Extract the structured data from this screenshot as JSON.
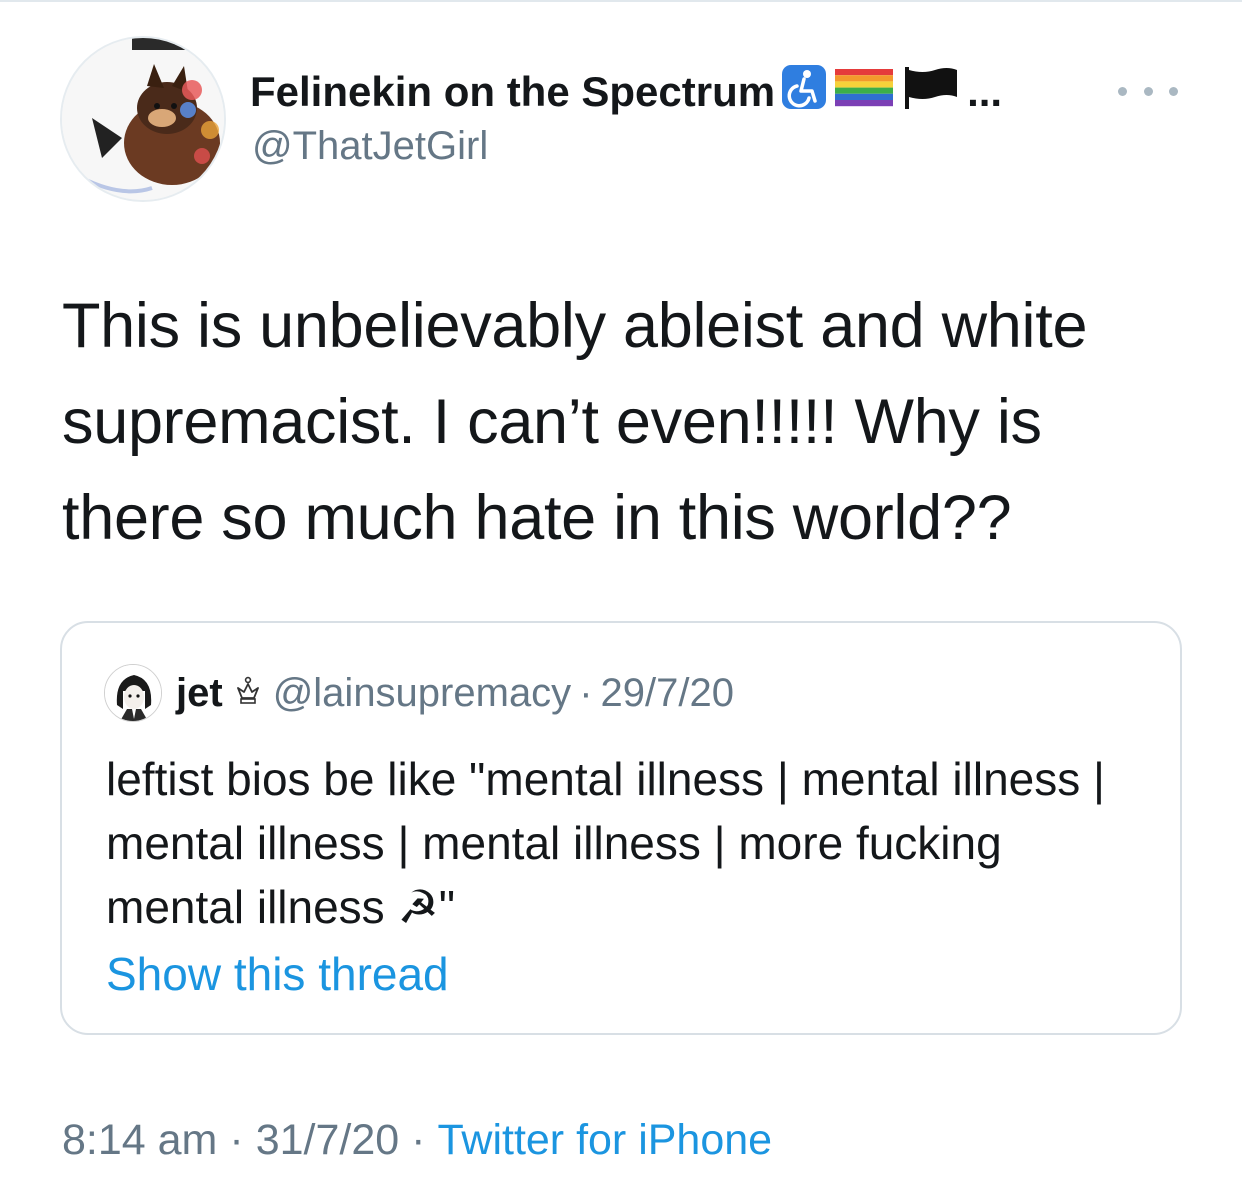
{
  "author": {
    "display_name": "Felinekin on the Spectrum",
    "name_overflow": "...",
    "handle": "@ThatJetGirl",
    "emoji": [
      "wheelchair-icon",
      "rainbow-flag-icon",
      "black-flag-icon"
    ]
  },
  "tweet": {
    "text": "This is unbelievably ableist and white supremacist. I can’t even!!!!! Why is there so much hate in this world??",
    "time": "8:14 am",
    "date": "31/7/20",
    "source": "Twitter for iPhone",
    "separator": "·"
  },
  "quoted": {
    "name": "jet",
    "name_icon": "crown-icon",
    "handle": "@lainsupremacy",
    "separator": "·",
    "date": "29/7/20",
    "text": "leftist bios be like \"mental illness | mental illness | mental illness | mental illness | more fucking mental illness ☭\"",
    "show_thread": "Show this thread"
  },
  "colors": {
    "text_primary": "#14171a",
    "text_secondary": "#657786",
    "link": "#1b95e0",
    "border": "#d8dfe5"
  }
}
